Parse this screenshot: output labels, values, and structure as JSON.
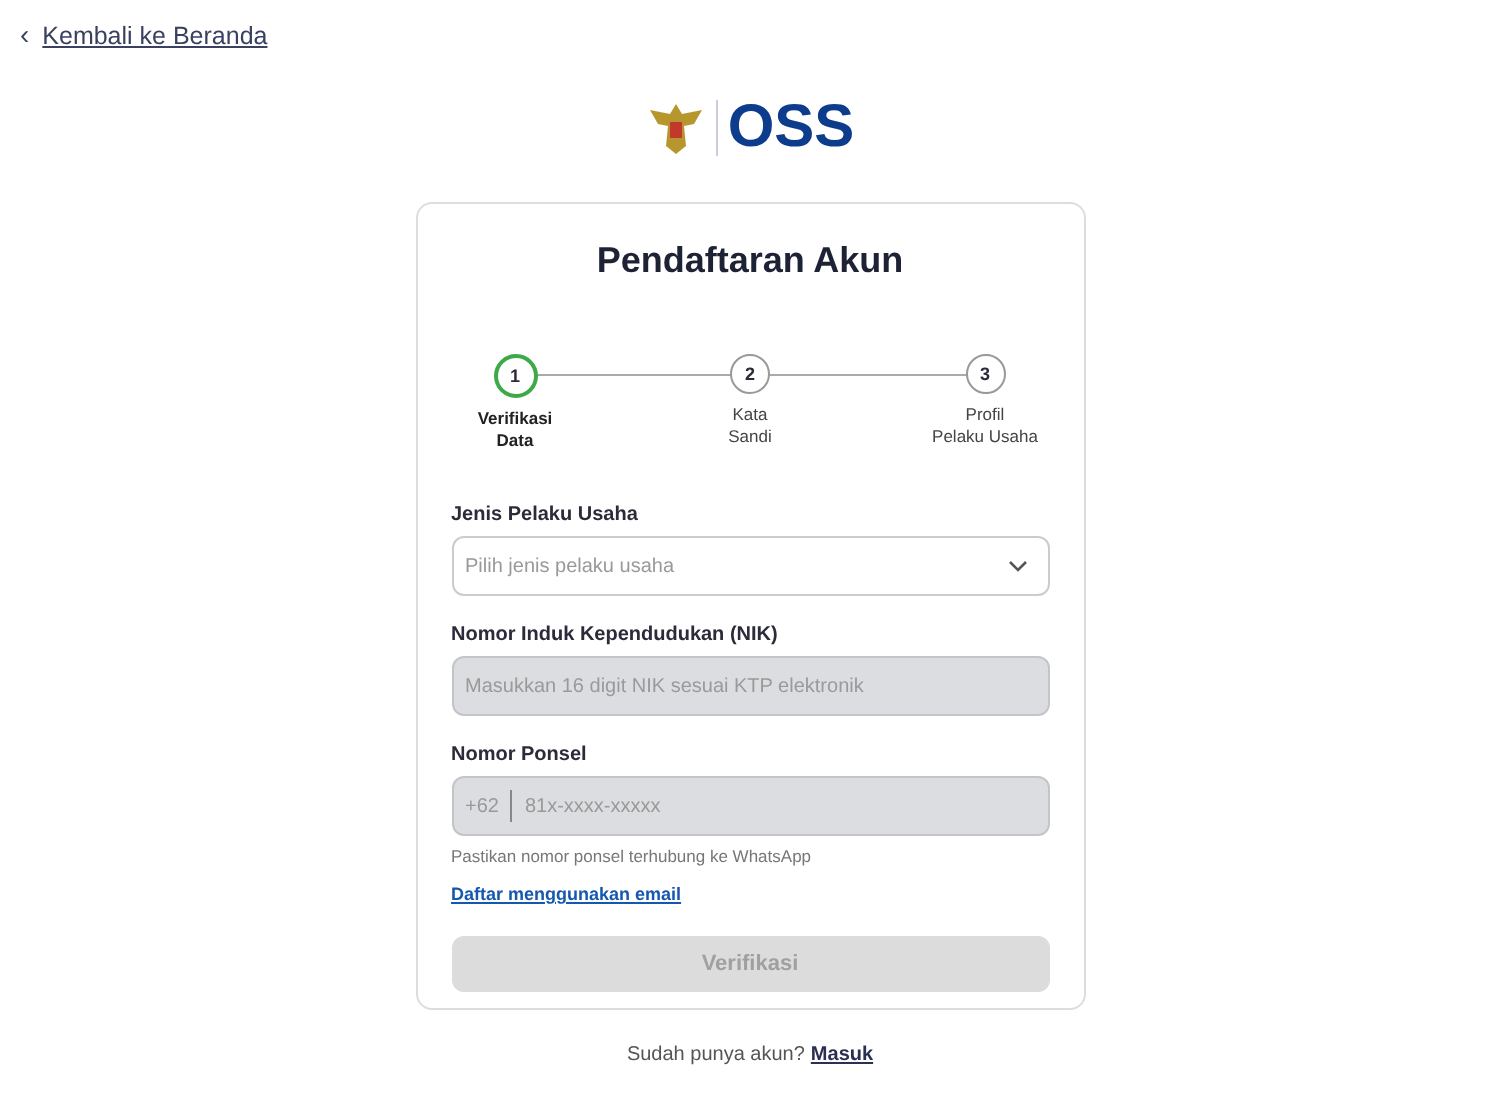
{
  "back_link": {
    "icon": "‹",
    "label": "Kembali ke Beranda"
  },
  "logo": {
    "text": "OSS"
  },
  "title": "Pendaftaran Akun",
  "steps": [
    {
      "number": "1",
      "label": [
        "Verifikasi",
        "Data"
      ],
      "selected": true
    },
    {
      "number": "2",
      "label": [
        "Kata",
        "Sandi"
      ],
      "selected": false
    },
    {
      "number": "3",
      "label": [
        "Profil",
        "Pelaku Usaha"
      ],
      "selected": false
    }
  ],
  "fields": [
    {
      "kind": "select",
      "label": "Jenis Pelaku Usaha",
      "placeholder": "Pilih jenis pelaku usaha",
      "disabled": false
    },
    {
      "kind": "text",
      "label": "Nomor Induk Kependudukan (NIK)",
      "placeholder": "Masukkan 16 digit NIK sesuai KTP elektronik",
      "disabled": true
    },
    {
      "kind": "phone",
      "label": "Nomor Ponsel",
      "prefix": "+62",
      "placeholder": "81x-xxxx-xxxxx",
      "disabled": true,
      "hint": "Pastikan nomor ponsel terhubung ke WhatsApp"
    }
  ],
  "email_link": "Daftar menggunakan email",
  "submit": {
    "label": "Verifikasi",
    "disabled": true
  },
  "footer": {
    "text": "Sudah punya akun?",
    "link": "Masuk"
  }
}
